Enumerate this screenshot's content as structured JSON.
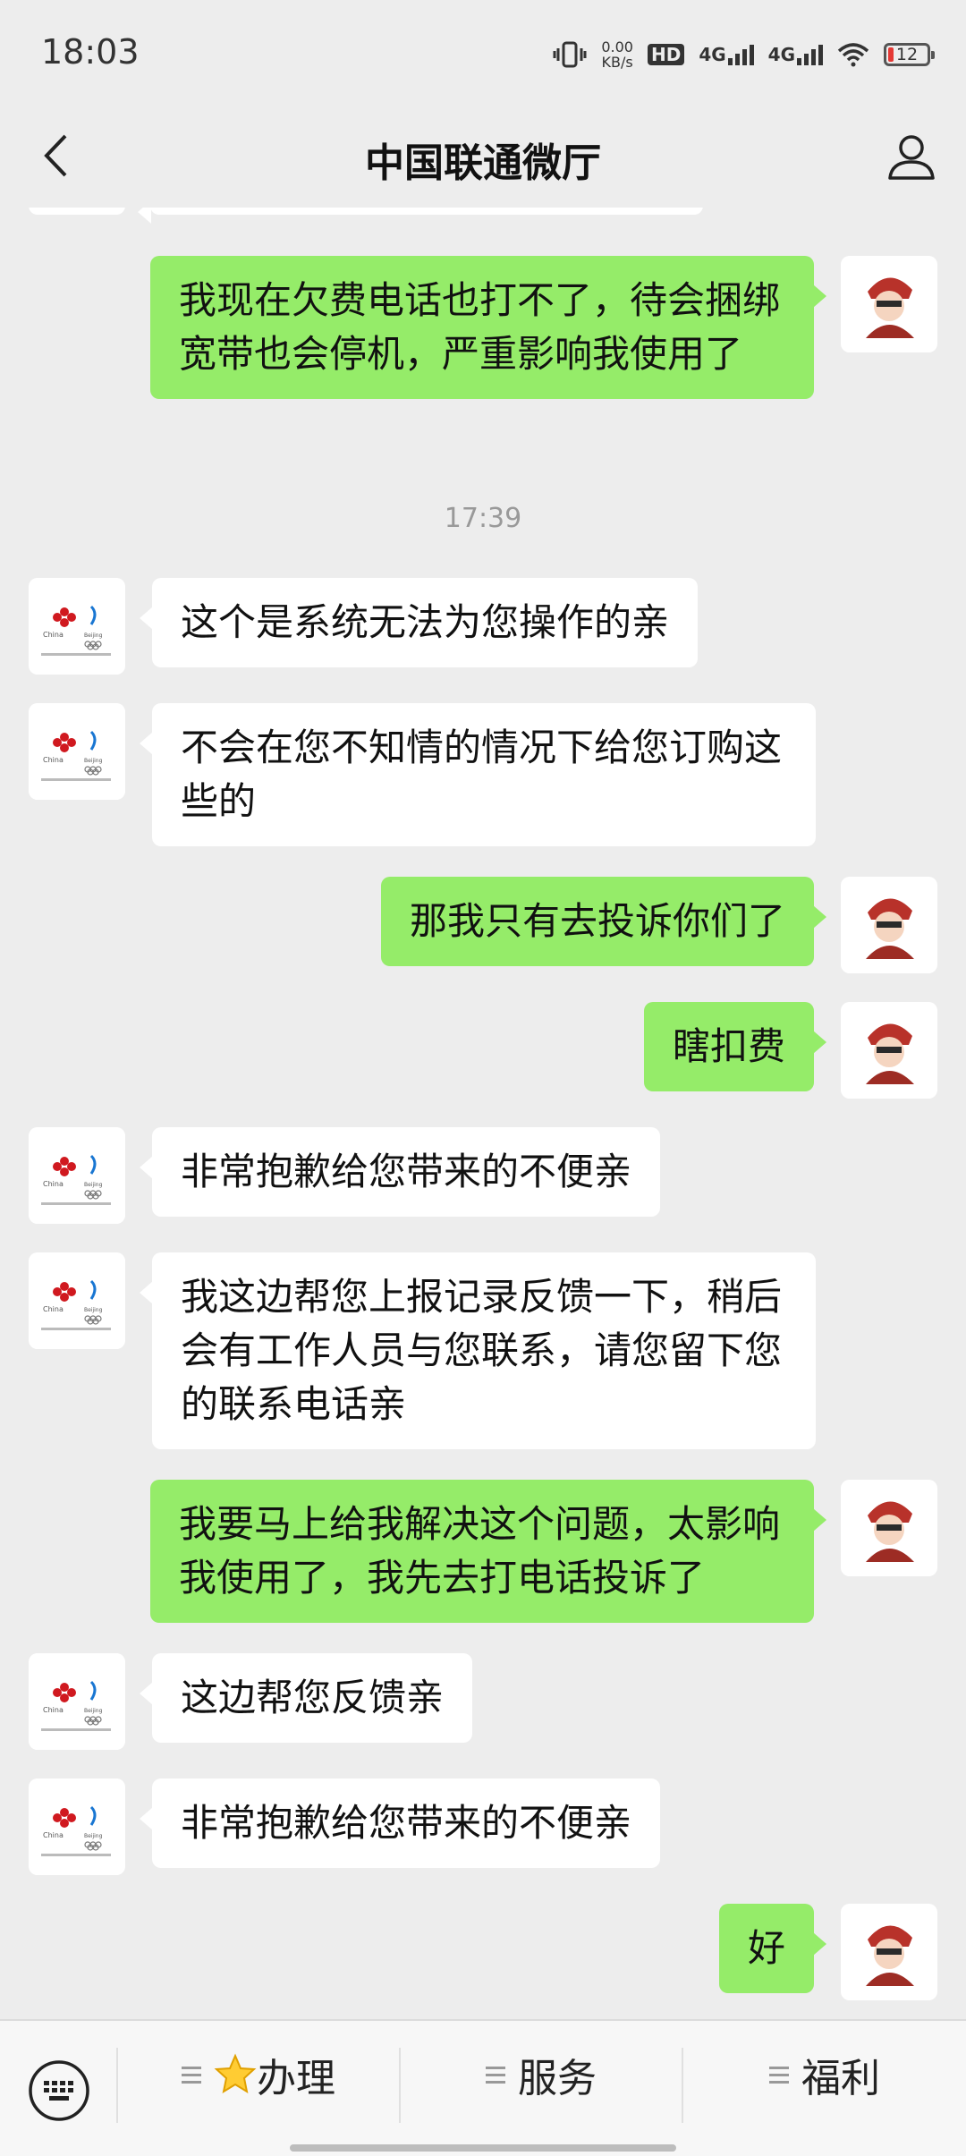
{
  "status_bar": {
    "time": "18:03",
    "speed_value": "0.00",
    "speed_unit": "KB/s",
    "hd_label": "HD",
    "sim1_label": "4G",
    "sim2_label": "4G",
    "battery_level": "12"
  },
  "header": {
    "title": "中国联通微厅"
  },
  "chat": {
    "messages": [
      {
        "side": "out",
        "text": "我现在欠费电话也打不了，待会捆绑宽带也会停机，严重影响我使用了"
      },
      {
        "side": "timestamp",
        "text": "17:39"
      },
      {
        "side": "in",
        "text": "这个是系统无法为您操作的亲"
      },
      {
        "side": "in",
        "text": "不会在您不知情的情况下给您订购这些的"
      },
      {
        "side": "out",
        "text": "那我只有去投诉你们了"
      },
      {
        "side": "out",
        "text": "瞎扣费"
      },
      {
        "side": "in",
        "text": "非常抱歉给您带来的不便亲"
      },
      {
        "side": "in",
        "text": "我这边帮您上报记录反馈一下，稍后会有工作人员与您联系，请您留下您的联系电话亲"
      },
      {
        "side": "out",
        "text": "我要马上给我解决这个问题，太影响我使用了，我先去打电话投诉了"
      },
      {
        "side": "in",
        "text": "这边帮您反馈亲"
      },
      {
        "side": "in",
        "text": "非常抱歉给您带来的不便亲"
      },
      {
        "side": "out",
        "text": "好"
      }
    ]
  },
  "bottom_menu": {
    "items": [
      {
        "icon": "star-icon",
        "label": "办理"
      },
      {
        "icon": "",
        "label": "服务"
      },
      {
        "icon": "",
        "label": "福利"
      }
    ]
  },
  "colors": {
    "outgoing_bubble": "#95ec69",
    "incoming_bubble": "#ffffff",
    "background": "#ededed"
  }
}
